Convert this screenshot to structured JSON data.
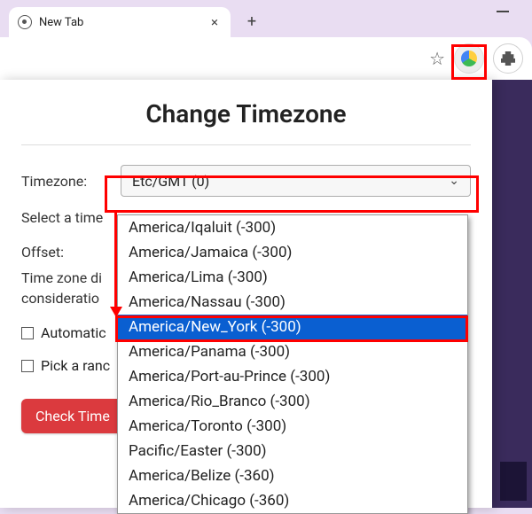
{
  "browser": {
    "tab_title": "New Tab",
    "close_glyph": "×",
    "plus_glyph": "+"
  },
  "popup": {
    "heading": "Change Timezone",
    "timezone_label": "Timezone:",
    "selected_timezone": "Etc/GMT (0)",
    "select_helper": "Select a time",
    "offset_label": "Offset:",
    "offset_helper_line1": "Time zone di",
    "offset_helper_line2": "consideratio",
    "automatic_label": "Automatic",
    "random_label": "Pick a ranc",
    "check_button": "Check Time"
  },
  "dropdown": {
    "options": [
      "America/Iqaluit (-300)",
      "America/Jamaica (-300)",
      "America/Lima (-300)",
      "America/Nassau (-300)",
      "America/New_York (-300)",
      "America/Panama (-300)",
      "America/Port-au-Prince (-300)",
      "America/Rio_Branco (-300)",
      "America/Toronto (-300)",
      "Pacific/Easter (-300)",
      "America/Belize (-360)",
      "America/Chicago (-360)"
    ],
    "selected_index": 4
  }
}
